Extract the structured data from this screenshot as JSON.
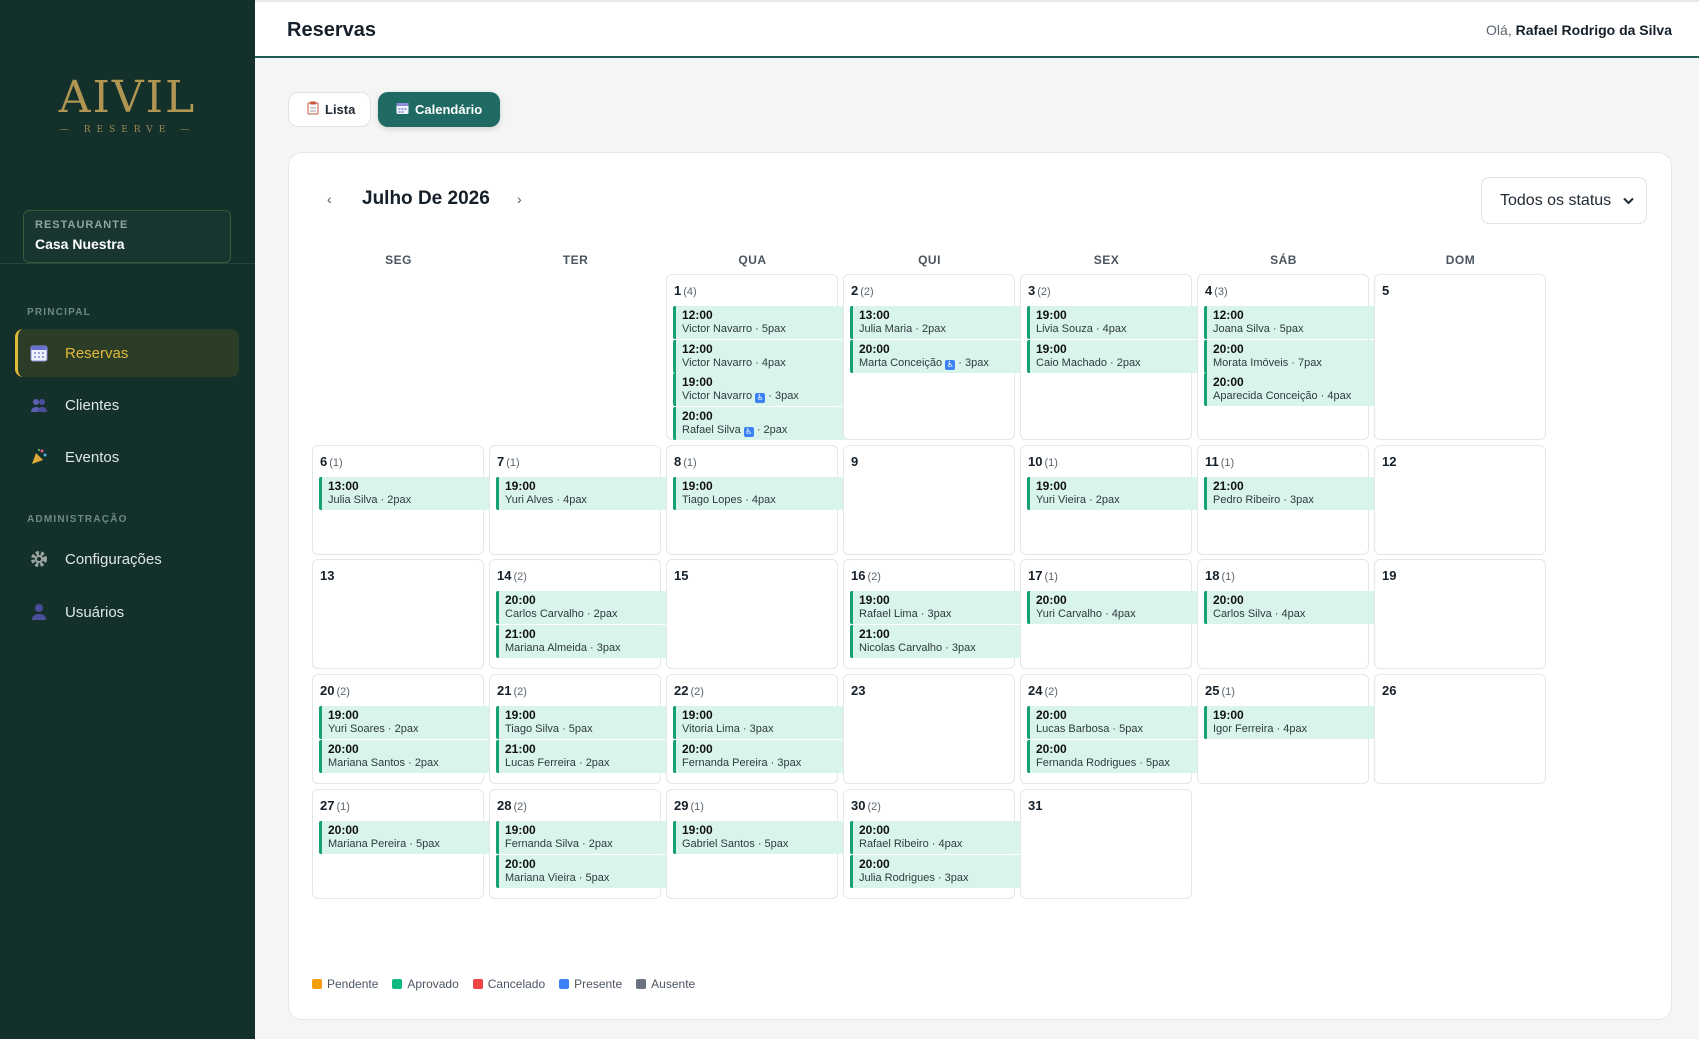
{
  "sidebar": {
    "logo_main": "AIVIL",
    "logo_sub": "— RESERVE —",
    "restaurant_label": "RESTAURANTE",
    "restaurant_name": "Casa Nuestra",
    "sections": [
      {
        "label": "PRINCIPAL",
        "items": [
          {
            "label": "Reservas",
            "icon": "calendar-icon",
            "active": true
          },
          {
            "label": "Clientes",
            "icon": "users-icon",
            "active": false
          },
          {
            "label": "Eventos",
            "icon": "party-icon",
            "active": false
          }
        ]
      },
      {
        "label": "ADMINISTRAÇÃO",
        "items": [
          {
            "label": "Configurações",
            "icon": "gear-icon",
            "active": false
          },
          {
            "label": "Usuários",
            "icon": "user-icon",
            "active": false
          }
        ]
      }
    ]
  },
  "header": {
    "title": "Reservas",
    "greeting": "Olá,",
    "user_name": "Rafael Rodrigo da Silva"
  },
  "views": {
    "lista": "Lista",
    "calendario": "Calendário"
  },
  "calendar": {
    "month_title": "Julho De 2026",
    "prev": "‹",
    "next": "›",
    "status_filter": "Todos os status",
    "weekdays": [
      "SEG",
      "TER",
      "QUA",
      "QUI",
      "SEX",
      "SÁB",
      "DOM"
    ],
    "first_weekday_index": 2,
    "days": [
      {
        "day": "1",
        "count": "(4)",
        "res": [
          {
            "time": "12:00",
            "info": "Victor Navarro · 5pax"
          },
          {
            "time": "12:00",
            "info": "Victor Navarro · 4pax"
          },
          {
            "time": "19:00",
            "info": "Victor Navarro",
            "acc": true,
            "pax": "3pax"
          },
          {
            "time": "20:00",
            "info": "Rafael Silva",
            "acc": true,
            "pax": "2pax"
          }
        ]
      },
      {
        "day": "2",
        "count": "(2)",
        "res": [
          {
            "time": "13:00",
            "info": "Julia Maria · 2pax"
          },
          {
            "time": "20:00",
            "info": "Marta Conceição",
            "acc": true,
            "pax": "3pax"
          }
        ]
      },
      {
        "day": "3",
        "count": "(2)",
        "res": [
          {
            "time": "19:00",
            "info": "Livia Souza · 4pax"
          },
          {
            "time": "19:00",
            "info": "Caio Machado · 2pax"
          }
        ]
      },
      {
        "day": "4",
        "count": "(3)",
        "res": [
          {
            "time": "12:00",
            "info": "Joana Silva · 5pax"
          },
          {
            "time": "20:00",
            "info": "Morata Imóveis · 7pax"
          },
          {
            "time": "20:00",
            "info": "Aparecida Conceição · 4pax"
          }
        ]
      },
      {
        "day": "5",
        "count": "",
        "res": []
      },
      {
        "day": "6",
        "count": "(1)",
        "res": [
          {
            "time": "13:00",
            "info": "Julia Silva · 2pax"
          }
        ]
      },
      {
        "day": "7",
        "count": "(1)",
        "res": [
          {
            "time": "19:00",
            "info": "Yuri Alves · 4pax"
          }
        ]
      },
      {
        "day": "8",
        "count": "(1)",
        "res": [
          {
            "time": "19:00",
            "info": "Tiago Lopes · 4pax"
          }
        ]
      },
      {
        "day": "9",
        "count": "",
        "res": []
      },
      {
        "day": "10",
        "count": "(1)",
        "res": [
          {
            "time": "19:00",
            "info": "Yuri Vieira · 2pax"
          }
        ]
      },
      {
        "day": "11",
        "count": "(1)",
        "res": [
          {
            "time": "21:00",
            "info": "Pedro Ribeiro · 3pax"
          }
        ]
      },
      {
        "day": "12",
        "count": "",
        "res": []
      },
      {
        "day": "13",
        "count": "",
        "res": []
      },
      {
        "day": "14",
        "count": "(2)",
        "res": [
          {
            "time": "20:00",
            "info": "Carlos Carvalho · 2pax"
          },
          {
            "time": "21:00",
            "info": "Mariana Almeida · 3pax"
          }
        ]
      },
      {
        "day": "15",
        "count": "",
        "res": []
      },
      {
        "day": "16",
        "count": "(2)",
        "res": [
          {
            "time": "19:00",
            "info": "Rafael Lima · 3pax"
          },
          {
            "time": "21:00",
            "info": "Nicolas Carvalho · 3pax"
          }
        ]
      },
      {
        "day": "17",
        "count": "(1)",
        "res": [
          {
            "time": "20:00",
            "info": "Yuri Carvalho · 4pax"
          }
        ]
      },
      {
        "day": "18",
        "count": "(1)",
        "res": [
          {
            "time": "20:00",
            "info": "Carlos Silva · 4pax"
          }
        ]
      },
      {
        "day": "19",
        "count": "",
        "res": []
      },
      {
        "day": "20",
        "count": "(2)",
        "res": [
          {
            "time": "19:00",
            "info": "Yuri Soares · 2pax"
          },
          {
            "time": "20:00",
            "info": "Mariana Santos · 2pax"
          }
        ]
      },
      {
        "day": "21",
        "count": "(2)",
        "res": [
          {
            "time": "19:00",
            "info": "Tiago Silva · 5pax"
          },
          {
            "time": "21:00",
            "info": "Lucas Ferreira · 2pax"
          }
        ]
      },
      {
        "day": "22",
        "count": "(2)",
        "res": [
          {
            "time": "19:00",
            "info": "Vitoria Lima · 3pax"
          },
          {
            "time": "20:00",
            "info": "Fernanda Pereira · 3pax"
          }
        ]
      },
      {
        "day": "23",
        "count": "",
        "res": []
      },
      {
        "day": "24",
        "count": "(2)",
        "res": [
          {
            "time": "20:00",
            "info": "Lucas Barbosa · 5pax"
          },
          {
            "time": "20:00",
            "info": "Fernanda Rodrigues · 5pax"
          }
        ]
      },
      {
        "day": "25",
        "count": "(1)",
        "res": [
          {
            "time": "19:00",
            "info": "Igor Ferreira · 4pax"
          }
        ]
      },
      {
        "day": "26",
        "count": "",
        "res": []
      },
      {
        "day": "27",
        "count": "(1)",
        "res": [
          {
            "time": "20:00",
            "info": "Mariana Pereira · 5pax"
          }
        ]
      },
      {
        "day": "28",
        "count": "(2)",
        "res": [
          {
            "time": "19:00",
            "info": "Fernanda Silva · 2pax"
          },
          {
            "time": "20:00",
            "info": "Mariana Vieira · 5pax"
          }
        ]
      },
      {
        "day": "29",
        "count": "(1)",
        "res": [
          {
            "time": "19:00",
            "info": "Gabriel Santos · 5pax"
          }
        ]
      },
      {
        "day": "30",
        "count": "(2)",
        "res": [
          {
            "time": "20:00",
            "info": "Rafael Ribeiro · 4pax"
          },
          {
            "time": "20:00",
            "info": "Julia Rodrigues · 3pax"
          }
        ]
      },
      {
        "day": "31",
        "count": "",
        "res": []
      }
    ],
    "legend": [
      {
        "label": "Pendente",
        "color": "#f59e0b"
      },
      {
        "label": "Aprovado",
        "color": "#10b981"
      },
      {
        "label": "Cancelado",
        "color": "#ef4444"
      },
      {
        "label": "Presente",
        "color": "#3b82f6"
      },
      {
        "label": "Ausente",
        "color": "#6b7280"
      }
    ]
  }
}
